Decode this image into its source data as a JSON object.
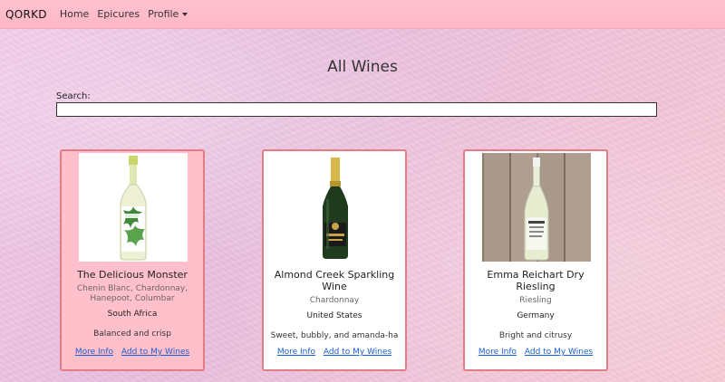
{
  "navbar": {
    "brand": "QORKD",
    "links": [
      "Home",
      "Epicures",
      "Profile"
    ]
  },
  "page": {
    "title": "All Wines",
    "search_label": "Search:",
    "search_value": ""
  },
  "wines": [
    {
      "name": "The Delicious Monster",
      "grape": "Chenin Blanc, Chardonnay, Hanepoot, Columbar",
      "region": "South Africa",
      "description": "Balanced and crisp",
      "more_info": "More Info",
      "add": "Add to My Wines"
    },
    {
      "name": "Almond Creek Sparkling Wine",
      "grape": "Chardonnay",
      "region": "United States",
      "description": "Sweet, bubbly, and amanda-ha",
      "more_info": "More Info",
      "add": "Add to My Wines"
    },
    {
      "name": "Emma Reichart Dry Riesling",
      "grape": "Riesling",
      "region": "Germany",
      "description": "Bright and citrusy",
      "more_info": "More Info",
      "add": "Add to My Wines"
    }
  ],
  "colors": {
    "navbar": "#ffb7c8",
    "card_border": "#e27d86",
    "card_pink": "#ffc0cb",
    "link": "#1a5fd0"
  }
}
